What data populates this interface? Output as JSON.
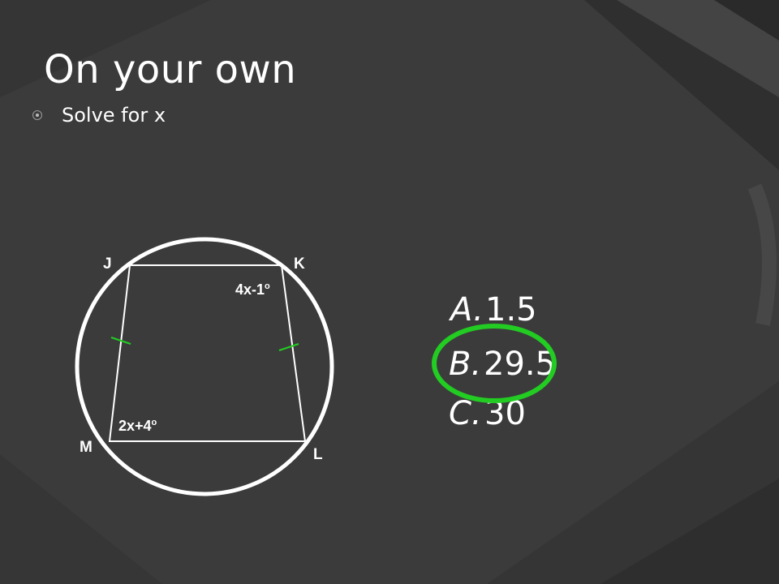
{
  "slide": {
    "title": "On your own",
    "bullet": "Solve for x"
  },
  "diagram": {
    "points": {
      "J": "J",
      "K": "K",
      "L": "L",
      "M": "M"
    },
    "angles": {
      "k": {
        "base": "4x-1",
        "sup": "o"
      },
      "m": {
        "base": "2x+4",
        "sup": "o"
      }
    }
  },
  "choices": [
    {
      "letter": "A.",
      "value": "1.5"
    },
    {
      "letter": "B.",
      "value": "29.5"
    },
    {
      "letter": "C.",
      "value": "30"
    }
  ],
  "highlight": {
    "selected_choice": "B.",
    "ring_color": "#22cc22"
  },
  "colors": {
    "background": "#3a3a3a",
    "stripe_dark": "#2a2a2a",
    "stripe_light": "#454545",
    "text": "#ffffff",
    "congruence_mark": "#22cc22"
  }
}
